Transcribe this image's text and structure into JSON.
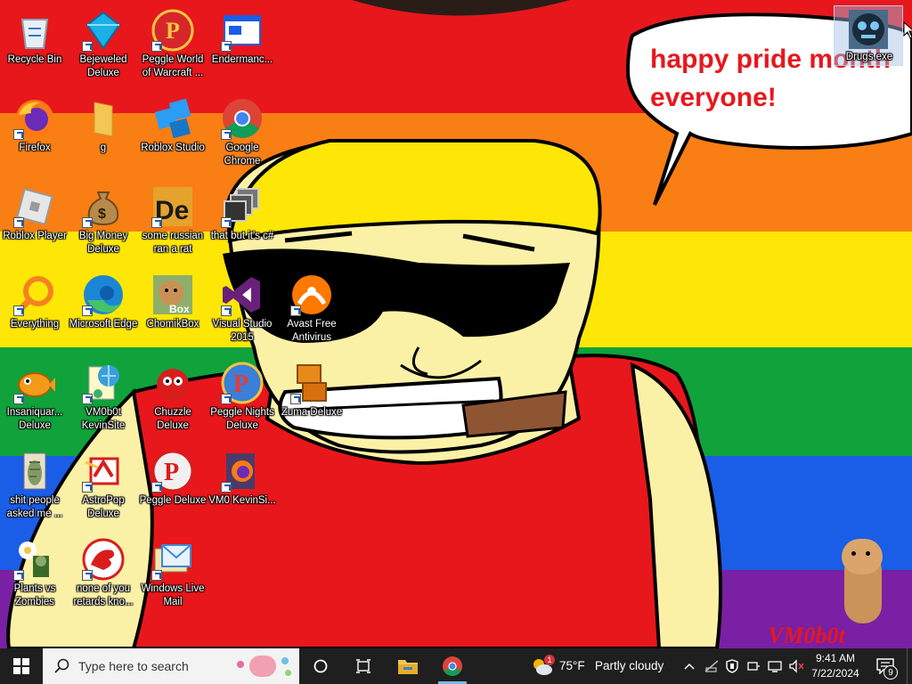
{
  "colors": {
    "stripe_red": "#e8171c",
    "stripe_orange": "#f97e14",
    "stripe_yellow": "#fee707",
    "stripe_green": "#10a23b",
    "stripe_blue": "#1a5de6",
    "stripe_purple": "#7a20a4",
    "taskbar": "#1f1f1f",
    "speech_text": "#e8171c"
  },
  "wallpaper": {
    "speech_text": "happy pride month everyone!",
    "watermark": "VM0b0t"
  },
  "desktop_icons": [
    {
      "label": "Recycle Bin",
      "icon": "recycle-bin-icon"
    },
    {
      "label": "Bejeweled Deluxe",
      "icon": "bejeweled-icon"
    },
    {
      "label": "Peggle World of Warcraft ...",
      "icon": "peggle-icon"
    },
    {
      "label": "Endermanc...",
      "icon": "window-icon"
    },
    {
      "label": "Firefox",
      "icon": "firefox-icon"
    },
    {
      "label": "g",
      "icon": "folder-icon"
    },
    {
      "label": "Roblox Studio",
      "icon": "roblox-studio-icon"
    },
    {
      "label": "Google Chrome",
      "icon": "chrome-icon"
    },
    {
      "label": "Roblox Player",
      "icon": "roblox-player-icon"
    },
    {
      "label": "Big Money Deluxe",
      "icon": "money-bag-icon"
    },
    {
      "label": "some russian ran a rat",
      "icon": "de-app-icon"
    },
    {
      "label": "that but it's c#",
      "icon": "stack-windows-icon"
    },
    {
      "label": "Everything",
      "icon": "magnifier-icon"
    },
    {
      "label": "Microsoft Edge",
      "icon": "edge-icon"
    },
    {
      "label": "ChomikBox",
      "icon": "chomikbox-icon"
    },
    {
      "label": "Visual Studio 2015",
      "icon": "visual-studio-icon"
    },
    {
      "label": "Avast Free Antivirus",
      "icon": "avast-icon"
    },
    {
      "label": "Insaniquar... Deluxe",
      "icon": "fish-icon"
    },
    {
      "label": "VM0b0t KevinSite",
      "icon": "globe-page-icon"
    },
    {
      "label": "Chuzzle Deluxe",
      "icon": "chuzzle-icon"
    },
    {
      "label": "Peggle Nights Deluxe",
      "icon": "peggle-nights-icon"
    },
    {
      "label": "Zuma Deluxe",
      "icon": "zuma-icon"
    },
    {
      "label": "shit people asked me ...",
      "icon": "document-icon"
    },
    {
      "label": "AstroPop Deluxe",
      "icon": "astropop-icon"
    },
    {
      "label": "Peggle Deluxe",
      "icon": "peggle-deluxe-icon"
    },
    {
      "label": "VM0 KevinSi...",
      "icon": "firefox-doc-icon"
    },
    {
      "label": "Plants vs Zombies",
      "icon": "pvz-icon"
    },
    {
      "label": "none of you retards kno...",
      "icon": "red-bird-icon"
    },
    {
      "label": "Windows Live Mail",
      "icon": "mail-icon"
    },
    {
      "label": "Drugs.exe",
      "icon": "drugs-exe-icon"
    }
  ],
  "taskbar": {
    "search_placeholder": "Type here to search",
    "weather_temp": "75°F",
    "weather_text": "Partly cloudy",
    "weather_badge": "1",
    "time": "9:41 AM",
    "date": "7/22/2024",
    "notification_count": "9"
  }
}
